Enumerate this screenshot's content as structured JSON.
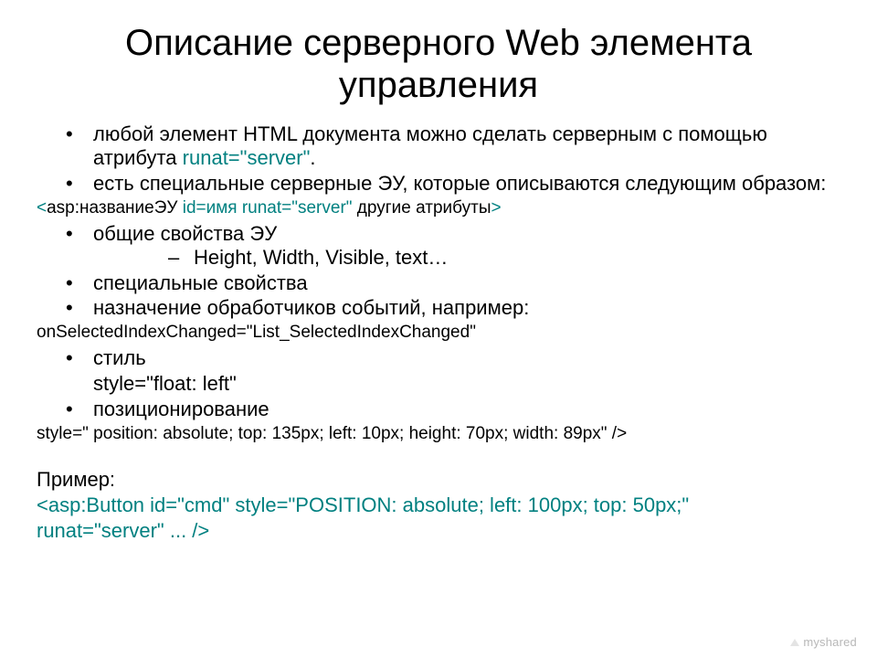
{
  "title": "Описание серверного Web элемента управления",
  "bullets": {
    "b1_pre": "любой элемент HTML документа можно сделать серверным с помощью атрибута ",
    "b1_code": "runat=\"server\"",
    "b1_post": ".",
    "b2": "есть специальные серверные ЭУ, которые описываются следующим образом:",
    "syntax_open": "<",
    "syntax_tag": "asp:названиеЭУ ",
    "syntax_attrs": "id=имя runat=\"server\"",
    "syntax_rest": " другие атрибуты",
    "syntax_close": ">",
    "b3": "общие свойства ЭУ",
    "b3_sub": "Height, Width, Visible, text…",
    "b4": "специальные свойства",
    "b5": "назначение обработчиков событий, например:",
    "code_evt": "onSelectedIndexChanged=\"List_SelectedIndexChanged\"",
    "b6": "стиль",
    "b6_code": "style=\"float: left\"",
    "b7": "позиционирование",
    "code_pos": "style=\" position: absolute; top: 135px; left: 10px; height: 70px; width: 89px\" />",
    "example_label": "Пример:",
    "ex_line1": "<asp:Button id=\"cmd\" style=\"POSITION: absolute; left: 100px; top: 50px;\"",
    "ex_line2": "runat=\"server\" ... />"
  },
  "brand": "myshared"
}
